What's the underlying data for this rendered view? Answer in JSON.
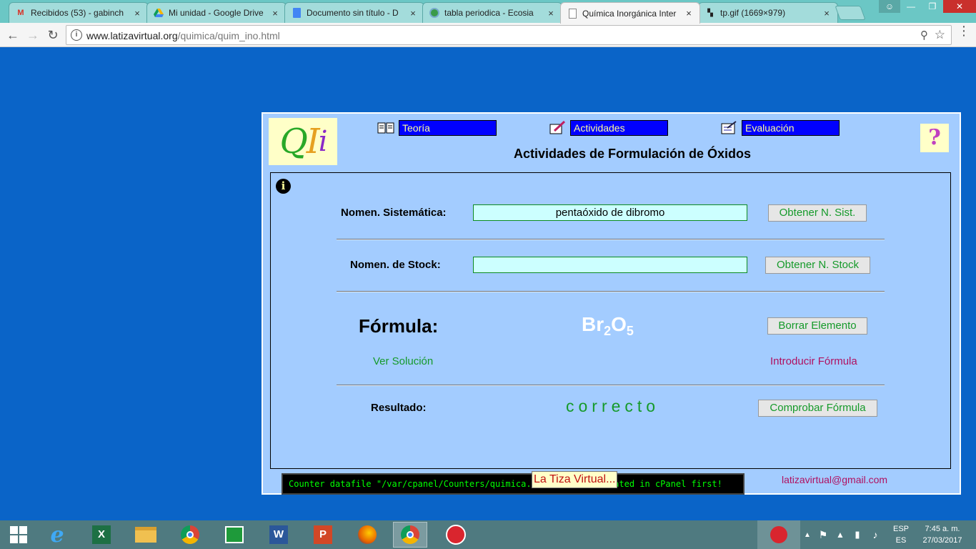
{
  "browser": {
    "tabs": [
      {
        "label": "Recibidos (53) - gabinch",
        "icon": "gmail-icon",
        "active": false
      },
      {
        "label": "Mi unidad - Google Drive",
        "icon": "drive-icon",
        "active": false
      },
      {
        "label": "Documento sin título - D",
        "icon": "docs-icon",
        "active": false
      },
      {
        "label": "tabla periodica - Ecosia",
        "icon": "ecosia-icon",
        "active": false
      },
      {
        "label": "Química Inorgánica Inter",
        "icon": "page-icon",
        "active": true
      },
      {
        "label": "tp.gif (1669×979)",
        "icon": "image-icon",
        "active": false
      }
    ],
    "url_host": "www.latizavirtual.org",
    "url_path": "/quimica/quim_ino.html",
    "close_glyph": "×"
  },
  "page": {
    "logo_text": [
      "Q",
      "I",
      "i"
    ],
    "nav": {
      "teoria": "Teoría",
      "actividades": "Actividades",
      "evaluacion": "Evaluación"
    },
    "help_glyph": "?",
    "title": "Actividades de Formulación de Óxidos",
    "info_glyph": "i",
    "sistematica_label": "Nomen. Sistemática:",
    "sistematica_value": "pentaóxido de dibromo",
    "obtener_sist_button": "Obtener N. Sist.",
    "stock_label": "Nomen. de Stock:",
    "stock_value": "",
    "obtener_stock_button": "Obtener N. Stock",
    "formula_label": "Fórmula:",
    "formula": {
      "el1": "Br",
      "n1": "2",
      "el2": "O",
      "n2": "5"
    },
    "borrar_button": "Borrar Elemento",
    "ver_solucion_link": "Ver Solución",
    "introducir_link": "Introducir Fórmula",
    "resultado_label": "Resultado:",
    "resultado_value": "correcto",
    "comprobar_button": "Comprobar Fórmula",
    "counter_text": "Counter datafile \"/var/cpanel/Counters/quimica.dat\" must be created in cPanel first!",
    "tooltip_text": "La Tiza Virtual...",
    "email": "latizavirtual@gmail.com"
  },
  "colors": {
    "page_bg": "#0a64c8",
    "panel_bg": "#a3ccff",
    "nav_bg": "#0000ff",
    "nav_text": "#ffff99",
    "accent_green": "#159a2a",
    "link_red": "#b01060"
  },
  "taskbar": {
    "apps": [
      "ie-icon",
      "excel-icon",
      "file-explorer-icon",
      "chrome-icon",
      "store-icon",
      "word-icon",
      "powerpoint-icon",
      "firefox-icon",
      "chrome-icon",
      "app-icon"
    ],
    "lang_line1": "ESP",
    "lang_line2": "ES",
    "time": "7:45 a. m.",
    "date": "27/03/2017"
  }
}
